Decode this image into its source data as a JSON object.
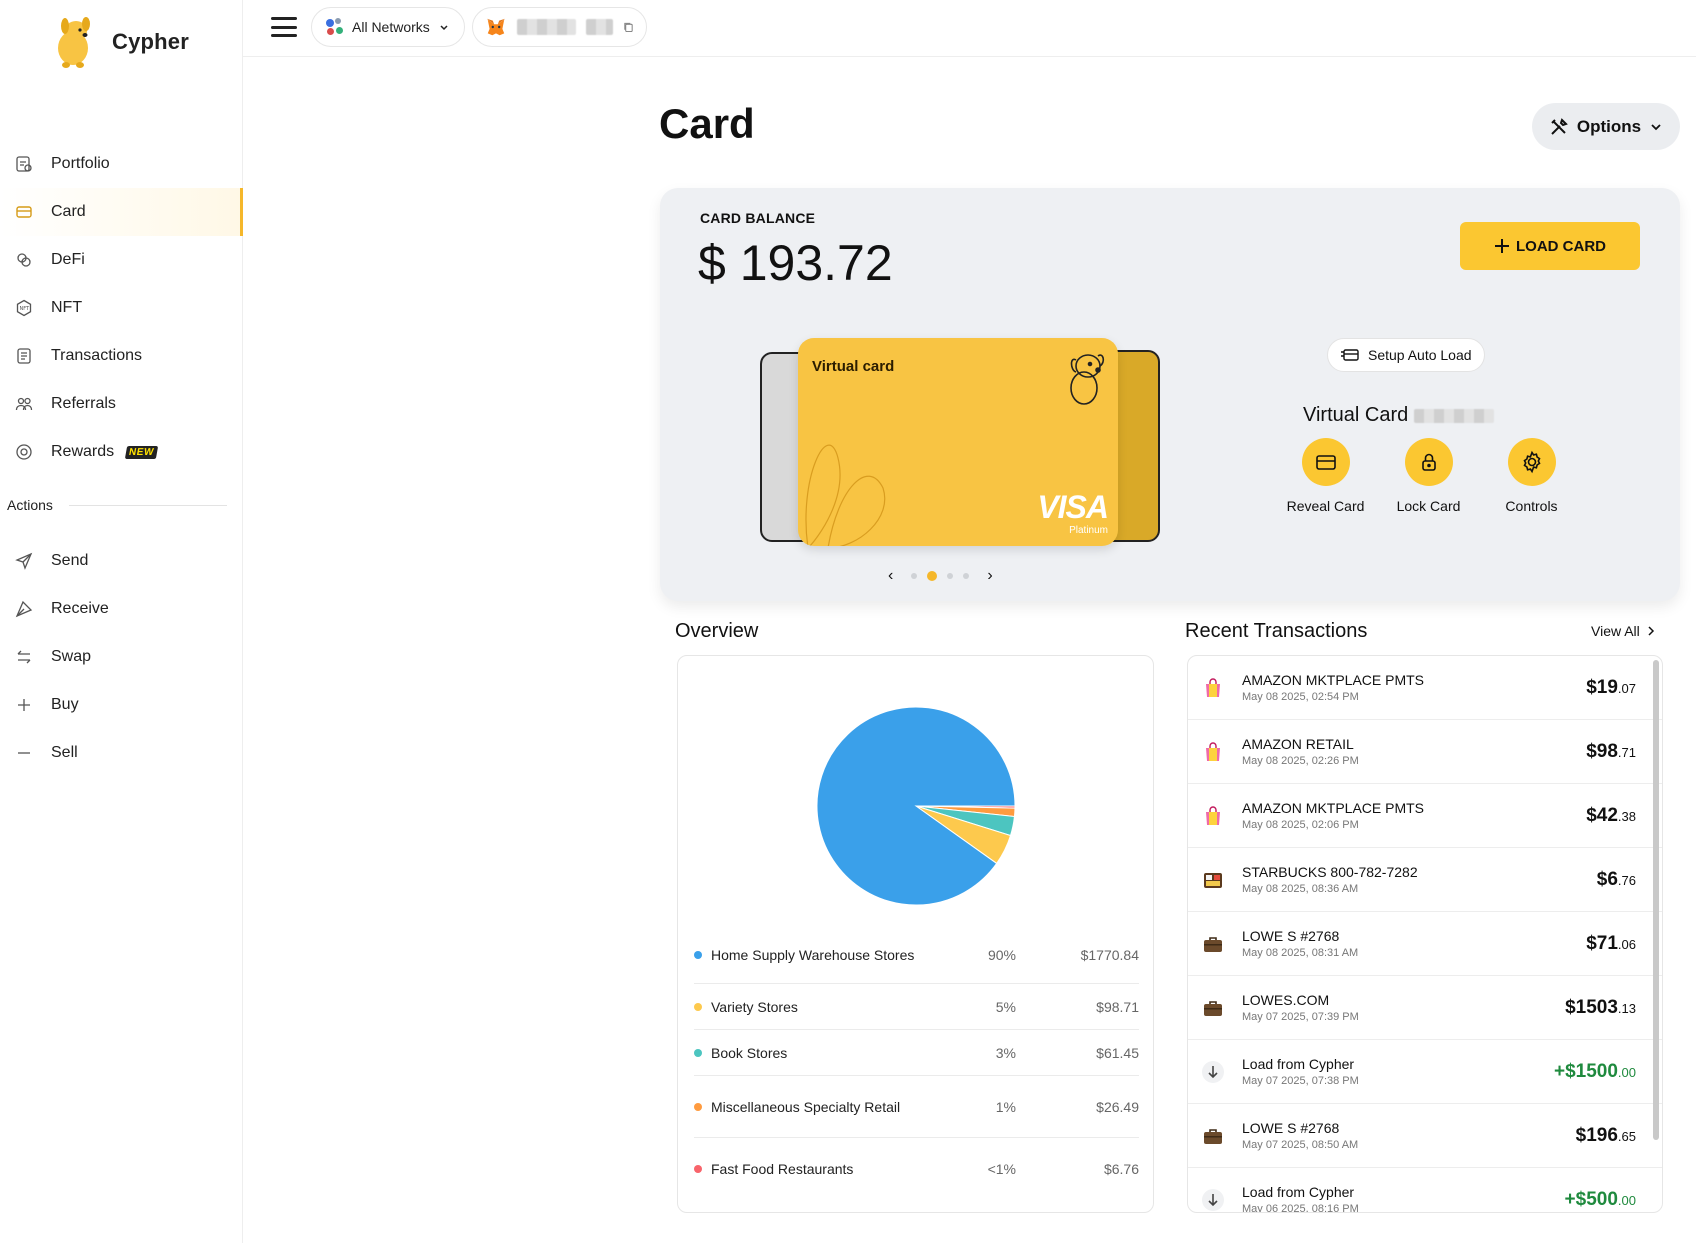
{
  "app": {
    "name": "Cypher"
  },
  "sidebar": {
    "items": [
      {
        "label": "Portfolio",
        "icon": "portfolio-icon"
      },
      {
        "label": "Card",
        "icon": "card-icon",
        "active": true
      },
      {
        "label": "DeFi",
        "icon": "defi-icon"
      },
      {
        "label": "NFT",
        "icon": "nft-icon"
      },
      {
        "label": "Transactions",
        "icon": "transactions-icon"
      },
      {
        "label": "Referrals",
        "icon": "referrals-icon"
      },
      {
        "label": "Rewards",
        "icon": "rewards-icon",
        "badge": "NEW"
      }
    ],
    "actions_label": "Actions",
    "actions": [
      {
        "label": "Send",
        "icon": "send-icon"
      },
      {
        "label": "Receive",
        "icon": "receive-icon"
      },
      {
        "label": "Swap",
        "icon": "swap-icon"
      },
      {
        "label": "Buy",
        "icon": "plus-icon"
      },
      {
        "label": "Sell",
        "icon": "minus-icon"
      }
    ]
  },
  "topbar": {
    "network_label": "All Networks"
  },
  "page": {
    "title": "Card",
    "options_label": "Options"
  },
  "card": {
    "balance_label": "CARD BALANCE",
    "balance": "$ 193.72",
    "load_label": "LOAD CARD",
    "card_face_label": "Virtual card",
    "card_brand": "VISA",
    "card_tier": "Platinum",
    "auto_load_label": "Setup Auto Load",
    "virtual_card_title": "Virtual Card",
    "actions": [
      {
        "label": "Reveal Card",
        "icon": "card-icon"
      },
      {
        "label": "Lock Card",
        "icon": "lock-icon"
      },
      {
        "label": "Controls",
        "icon": "gear-icon"
      }
    ],
    "pager": {
      "count": 4,
      "active": 1
    }
  },
  "overview": {
    "title": "Overview",
    "colors": {
      "home": "#3aa0ea",
      "variety": "#fdc94d",
      "book": "#4cc5c0",
      "misc": "#ff9b3f",
      "fastfood": "#f8646b"
    },
    "legend": [
      {
        "name": "Home Supply Warehouse Stores",
        "pct": "90%",
        "amount": "$1770.84",
        "color": "#3aa0ea"
      },
      {
        "name": "Variety Stores",
        "pct": "5%",
        "amount": "$98.71",
        "color": "#fdc94d"
      },
      {
        "name": "Book Stores",
        "pct": "3%",
        "amount": "$61.45",
        "color": "#4cc5c0"
      },
      {
        "name": "Miscellaneous Specialty Retail",
        "pct": "1%",
        "amount": "$26.49",
        "color": "#ff9b3f"
      },
      {
        "name": "Fast Food Restaurants",
        "pct": "<1%",
        "amount": "$6.76",
        "color": "#f8646b"
      }
    ]
  },
  "chart_data": {
    "type": "pie",
    "categories": [
      "Home Supply Warehouse Stores",
      "Variety Stores",
      "Book Stores",
      "Miscellaneous Specialty Retail",
      "Fast Food Restaurants"
    ],
    "values": [
      1770.84,
      98.71,
      61.45,
      26.49,
      6.76
    ],
    "colors": [
      "#3aa0ea",
      "#fdc94d",
      "#4cc5c0",
      "#ff9b3f",
      "#f8646b"
    ]
  },
  "transactions": {
    "title": "Recent Transactions",
    "view_all_label": "View All",
    "items": [
      {
        "name": "AMAZON MKTPLACE PMTS",
        "date": "May 08 2025, 02:54 PM",
        "dollars": "$19",
        "cents": ".07",
        "icon": "shopping-bag-icon",
        "positive": false
      },
      {
        "name": "AMAZON RETAIL",
        "date": "May 08 2025, 02:26 PM",
        "dollars": "$98",
        "cents": ".71",
        "icon": "shopping-bag-icon",
        "positive": false
      },
      {
        "name": "AMAZON MKTPLACE PMTS",
        "date": "May 08 2025, 02:06 PM",
        "dollars": "$42",
        "cents": ".38",
        "icon": "shopping-bag-icon",
        "positive": false
      },
      {
        "name": "STARBUCKS 800-782-7282",
        "date": "May 08 2025, 08:36 AM",
        "dollars": "$6",
        "cents": ".76",
        "icon": "bento-icon",
        "positive": false
      },
      {
        "name": "LOWE S #2768",
        "date": "May 08 2025, 08:31 AM",
        "dollars": "$71",
        "cents": ".06",
        "icon": "briefcase-icon",
        "positive": false
      },
      {
        "name": "LOWES.COM",
        "date": "May 07 2025, 07:39 PM",
        "dollars": "$1503",
        "cents": ".13",
        "icon": "briefcase-icon",
        "positive": false
      },
      {
        "name": "Load from Cypher",
        "date": "May 07 2025, 07:38 PM",
        "dollars": "+$1500",
        "cents": ".00",
        "icon": "arrow-down-icon",
        "positive": true
      },
      {
        "name": "LOWE S #2768",
        "date": "May 07 2025, 08:50 AM",
        "dollars": "$196",
        "cents": ".65",
        "icon": "briefcase-icon",
        "positive": false
      },
      {
        "name": "Load from Cypher",
        "date": "May 06 2025, 08:16 PM",
        "dollars": "+$500",
        "cents": ".00",
        "icon": "arrow-down-icon",
        "positive": true
      }
    ]
  }
}
